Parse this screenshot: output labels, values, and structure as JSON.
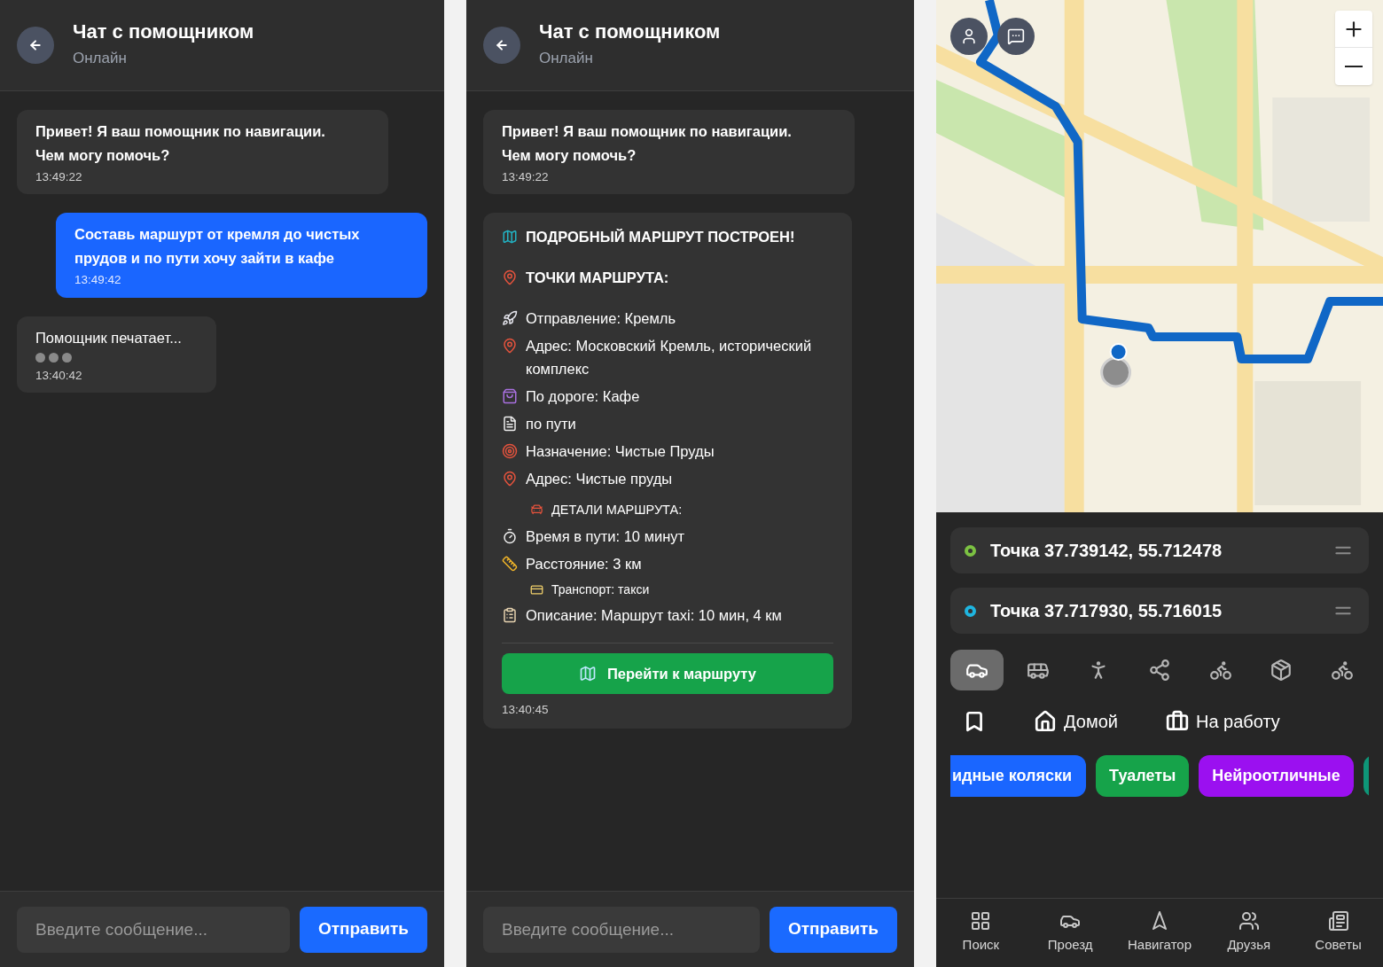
{
  "chat_panels": [
    {
      "header": {
        "title": "Чат с помощником",
        "status": "Онлайн"
      },
      "messages": [
        {
          "kind": "bot",
          "text": "Привет! Я ваш помощник по навигации. Чем могу помочь?",
          "time": "13:49:22"
        },
        {
          "kind": "user",
          "text": "Составь маршурт от кремля до чистых прудов и по пути хочу зайти в кафе",
          "time": "13:49:42"
        },
        {
          "kind": "typing",
          "text": "Помощник печатает...",
          "time": "13:40:42"
        }
      ],
      "input": {
        "placeholder": "Введите сообщение..."
      },
      "send_button": "Отправить"
    },
    {
      "header": {
        "title": "Чат с помощником",
        "status": "Онлайн"
      },
      "messages": [
        {
          "kind": "bot",
          "text": "Привет! Я ваш помощник по навигации. Чем могу помочь?",
          "time": "13:49:22"
        },
        {
          "kind": "route",
          "lines": [
            {
              "kind": "heading",
              "text": "ПОДРОБНЫЙ МАРШРУТ ПОСТРОЕН!"
            },
            {
              "kind": "heading",
              "text": "ТОЧКИ МАРШРУТА:"
            },
            {
              "kind": "item",
              "text": "Отправление: Кремль"
            },
            {
              "kind": "item",
              "text": "Адрес: Московский Кремль, исторический комплекс"
            },
            {
              "kind": "item",
              "text": "По дороге: Кафе"
            },
            {
              "kind": "item",
              "text": "по пути"
            },
            {
              "kind": "item",
              "text": "Назначение: Чистые Пруды"
            },
            {
              "kind": "item",
              "text": "Адрес: Чистые пруды"
            },
            {
              "kind": "subheading",
              "text": "ДЕТАЛИ МАРШРУТА:"
            },
            {
              "kind": "item",
              "text": "Время в пути: 10 минут"
            },
            {
              "kind": "item",
              "text": "Расстояние: 3 км"
            },
            {
              "kind": "subitem",
              "text": "Транспорт: такси"
            },
            {
              "kind": "item",
              "text": "Описание: Маршрут taxi: 10 мин, 4 км"
            }
          ],
          "button": "Перейти к маршруту",
          "time": "13:40:45"
        }
      ],
      "input": {
        "placeholder": "Введите сообщение..."
      },
      "send_button": "Отправить"
    }
  ],
  "map_panel": {
    "route_points": [
      {
        "label": "Точка 37.739142, 55.712478",
        "color": "#7cc242"
      },
      {
        "label": "Точка 37.717930, 55.716015",
        "color": "#1fb5e0"
      }
    ],
    "transport_modes": [
      {
        "selected": true
      },
      {
        "selected": false
      },
      {
        "selected": false
      },
      {
        "selected": false
      },
      {
        "selected": false
      },
      {
        "selected": false
      },
      {
        "selected": false
      }
    ],
    "shortcuts": [
      "Домой",
      "На работу"
    ],
    "chips": [
      {
        "label": "идные коляски",
        "color": "#1a66ff"
      },
      {
        "label": "Туалеты",
        "color": "#16a34a"
      },
      {
        "label": "Нейроотличные",
        "color": "#9b10f0"
      },
      {
        "color": "#0e9678"
      }
    ],
    "bottom_nav": [
      "Поиск",
      "Проезд",
      "Навигатор",
      "Друзья",
      "Советы"
    ]
  }
}
